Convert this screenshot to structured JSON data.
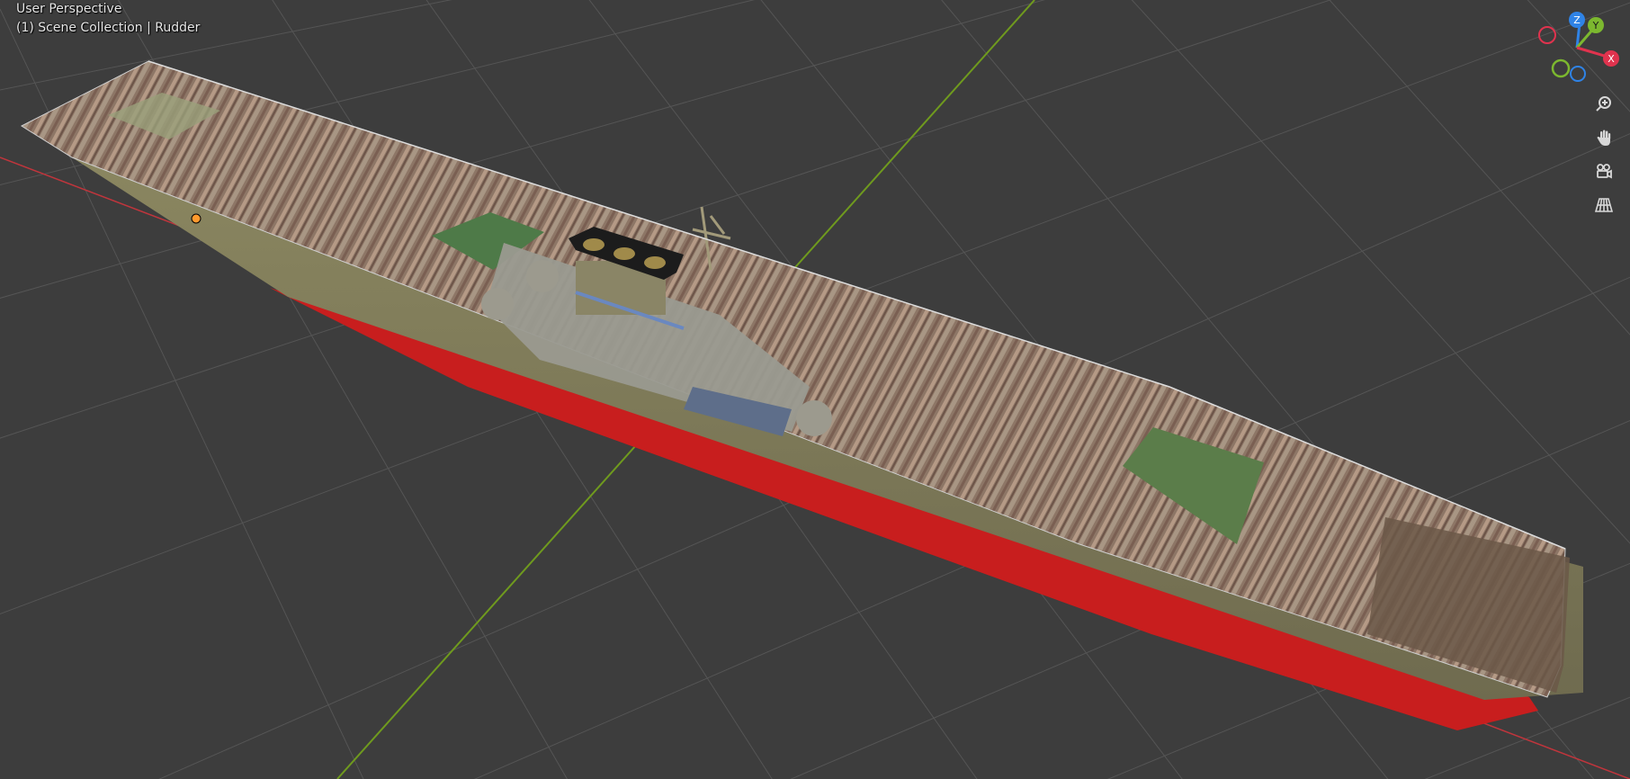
{
  "viewport": {
    "perspective_label": "User Perspective",
    "collection_label": "(1) Scene Collection | Rudder"
  },
  "gizmo": {
    "axes": [
      {
        "name": "Z",
        "color": "#2f83e6"
      },
      {
        "name": "Y",
        "color": "#7cb82f"
      },
      {
        "name": "X",
        "color": "#e0334e"
      }
    ]
  },
  "nav_tools": [
    {
      "icon": "zoom-icon"
    },
    {
      "icon": "hand-pan-icon"
    },
    {
      "icon": "camera-view-icon"
    },
    {
      "icon": "perspective-grid-icon"
    }
  ],
  "colors": {
    "background": "#3d3d3d",
    "grid_line": "#555555",
    "axis_x": "#c0353c",
    "axis_y": "#6f9a1e",
    "hull_red": "#c81e1e",
    "deck_wood": "#8c7462",
    "origin_dot": "#ff9a2e"
  }
}
